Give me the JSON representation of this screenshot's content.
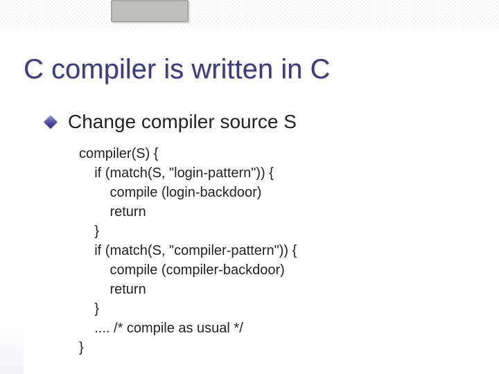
{
  "slide": {
    "title": "C compiler is written in C",
    "bullet": "Change compiler source S",
    "code": "compiler(S) {\n    if (match(S, \"login-pattern\")) {\n        compile (login-backdoor)\n        return\n    }\n    if (match(S, \"compiler-pattern\")) {\n        compile (compiler-backdoor)\n        return\n    }\n    .... /* compile as usual */\n}"
  }
}
